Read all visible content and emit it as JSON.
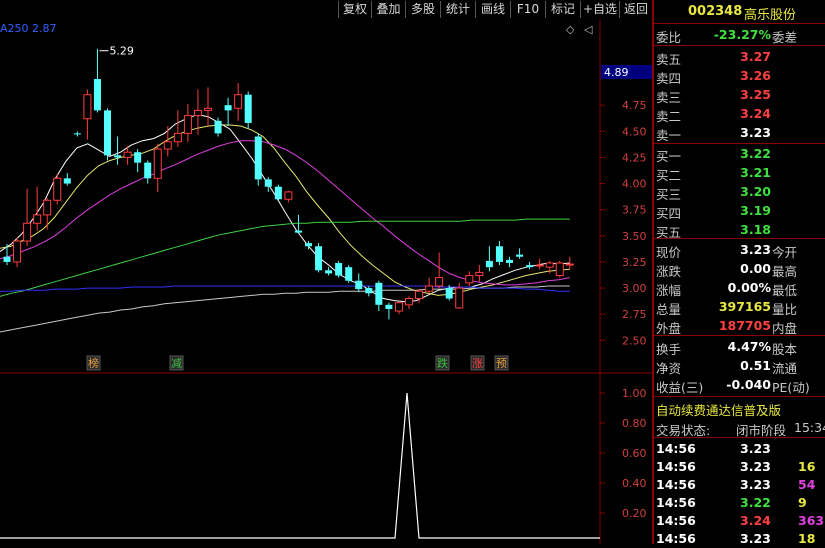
{
  "toolbar": {
    "buttons": [
      "复权",
      "叠加",
      "多股",
      "统计",
      "画线",
      "F10",
      "标记",
      "+自选",
      "返回"
    ]
  },
  "main_chart": {
    "indicator_label": "A250",
    "indicator_value": "2.87",
    "high_label": "5.29",
    "price_marker": "4.89",
    "y_ticks": [
      "4.75",
      "4.50",
      "4.25",
      "4.00",
      "3.75",
      "3.50",
      "3.25",
      "3.00",
      "2.75",
      "2.50"
    ],
    "markers": [
      {
        "text": "榜",
        "color": "#e8a040"
      },
      {
        "text": "减",
        "color": "#40c040"
      },
      {
        "text": "跌",
        "color": "#40c040"
      },
      {
        "text": "涨",
        "color": "#ff4040"
      },
      {
        "text": "预",
        "color": "#e8a040"
      }
    ]
  },
  "sub_chart": {
    "y_ticks": [
      "1.00",
      "0.80",
      "0.60",
      "0.40",
      "0.20"
    ],
    "signal_value": 1.0
  },
  "chart_data": {
    "type": "candlestick",
    "candles": [
      {
        "o": 3.3,
        "h": 3.42,
        "l": 3.22,
        "c": 3.25
      },
      {
        "o": 3.25,
        "h": 3.48,
        "l": 3.2,
        "c": 3.45
      },
      {
        "o": 3.45,
        "h": 3.95,
        "l": 3.4,
        "c": 3.62
      },
      {
        "o": 3.62,
        "h": 3.97,
        "l": 3.55,
        "c": 3.7
      },
      {
        "o": 3.7,
        "h": 3.86,
        "l": 3.56,
        "c": 3.84
      },
      {
        "o": 3.84,
        "h": 4.09,
        "l": 3.8,
        "c": 4.05
      },
      {
        "o": 4.05,
        "h": 4.1,
        "l": 3.98,
        "c": 4.0
      },
      {
        "o": 4.48,
        "h": 4.5,
        "l": 4.45,
        "c": 4.47
      },
      {
        "o": 4.62,
        "h": 4.9,
        "l": 4.42,
        "c": 4.85
      },
      {
        "o": 5.0,
        "h": 5.29,
        "l": 4.68,
        "c": 4.7
      },
      {
        "o": 4.7,
        "h": 4.72,
        "l": 4.22,
        "c": 4.27
      },
      {
        "o": 4.27,
        "h": 4.45,
        "l": 4.18,
        "c": 4.25
      },
      {
        "o": 4.25,
        "h": 4.36,
        "l": 4.18,
        "c": 4.3
      },
      {
        "o": 4.3,
        "h": 4.33,
        "l": 4.11,
        "c": 4.2
      },
      {
        "o": 4.2,
        "h": 4.22,
        "l": 4.0,
        "c": 4.05
      },
      {
        "o": 4.05,
        "h": 4.38,
        "l": 3.92,
        "c": 4.33
      },
      {
        "o": 4.33,
        "h": 4.55,
        "l": 4.26,
        "c": 4.4
      },
      {
        "o": 4.4,
        "h": 4.7,
        "l": 4.35,
        "c": 4.48
      },
      {
        "o": 4.48,
        "h": 4.76,
        "l": 4.4,
        "c": 4.65
      },
      {
        "o": 4.65,
        "h": 4.9,
        "l": 4.47,
        "c": 4.7
      },
      {
        "o": 4.7,
        "h": 4.92,
        "l": 4.55,
        "c": 4.72
      },
      {
        "o": 4.6,
        "h": 4.63,
        "l": 4.45,
        "c": 4.48
      },
      {
        "o": 4.75,
        "h": 4.82,
        "l": 4.55,
        "c": 4.7
      },
      {
        "o": 4.72,
        "h": 4.96,
        "l": 4.6,
        "c": 4.85
      },
      {
        "o": 4.85,
        "h": 4.88,
        "l": 4.53,
        "c": 4.58
      },
      {
        "o": 4.45,
        "h": 4.48,
        "l": 3.98,
        "c": 4.04
      },
      {
        "o": 4.04,
        "h": 4.06,
        "l": 3.92,
        "c": 3.97
      },
      {
        "o": 3.97,
        "h": 3.99,
        "l": 3.83,
        "c": 3.85
      },
      {
        "o": 3.85,
        "h": 3.93,
        "l": 3.82,
        "c": 3.92
      },
      {
        "o": 3.55,
        "h": 3.7,
        "l": 3.52,
        "c": 3.53
      },
      {
        "o": 3.43,
        "h": 3.45,
        "l": 3.37,
        "c": 3.4
      },
      {
        "o": 3.4,
        "h": 3.43,
        "l": 3.15,
        "c": 3.17
      },
      {
        "o": 3.17,
        "h": 3.2,
        "l": 3.12,
        "c": 3.14
      },
      {
        "o": 3.24,
        "h": 3.26,
        "l": 3.1,
        "c": 3.12
      },
      {
        "o": 3.2,
        "h": 3.22,
        "l": 3.05,
        "c": 3.07
      },
      {
        "o": 3.07,
        "h": 3.14,
        "l": 2.96,
        "c": 2.99
      },
      {
        "o": 3.0,
        "h": 3.02,
        "l": 2.92,
        "c": 2.95
      },
      {
        "o": 3.05,
        "h": 3.07,
        "l": 2.78,
        "c": 2.84
      },
      {
        "o": 2.84,
        "h": 2.86,
        "l": 2.7,
        "c": 2.8
      },
      {
        "o": 2.78,
        "h": 2.87,
        "l": 2.75,
        "c": 2.86
      },
      {
        "o": 2.84,
        "h": 2.92,
        "l": 2.8,
        "c": 2.9
      },
      {
        "o": 2.9,
        "h": 2.99,
        "l": 2.86,
        "c": 2.97
      },
      {
        "o": 2.97,
        "h": 3.1,
        "l": 2.95,
        "c": 3.02
      },
      {
        "o": 3.02,
        "h": 3.34,
        "l": 3.0,
        "c": 3.1
      },
      {
        "o": 3.0,
        "h": 3.03,
        "l": 2.88,
        "c": 2.9
      },
      {
        "o": 2.81,
        "h": 3.05,
        "l": 2.8,
        "c": 3.0
      },
      {
        "o": 3.05,
        "h": 3.16,
        "l": 3.02,
        "c": 3.12
      },
      {
        "o": 3.12,
        "h": 3.22,
        "l": 3.06,
        "c": 3.15
      },
      {
        "o": 3.26,
        "h": 3.4,
        "l": 3.16,
        "c": 3.2
      },
      {
        "o": 3.4,
        "h": 3.45,
        "l": 3.22,
        "c": 3.25
      },
      {
        "o": 3.27,
        "h": 3.3,
        "l": 3.2,
        "c": 3.24
      },
      {
        "o": 3.32,
        "h": 3.38,
        "l": 3.28,
        "c": 3.3
      },
      {
        "o": 3.22,
        "h": 3.25,
        "l": 3.18,
        "c": 3.2
      },
      {
        "o": 3.22,
        "h": 3.28,
        "l": 3.18,
        "c": 3.22
      },
      {
        "o": 3.2,
        "h": 3.26,
        "l": 3.14,
        "c": 3.24
      },
      {
        "o": 3.12,
        "h": 3.26,
        "l": 3.1,
        "c": 3.24
      },
      {
        "o": 3.23,
        "h": 3.3,
        "l": 3.18,
        "c": 3.23
      }
    ],
    "ma_lines": [
      {
        "name": "ma5",
        "color": "#ffffff",
        "values": [
          3.35,
          3.42,
          3.52,
          3.66,
          3.82,
          4.04,
          4.21,
          4.34,
          4.38,
          4.32,
          4.26,
          4.3,
          4.37,
          4.41,
          4.43,
          4.48,
          4.57,
          4.62,
          4.66,
          4.64,
          4.58,
          4.52,
          4.38,
          4.24,
          4.07,
          3.91,
          3.73,
          3.56,
          3.42,
          3.3,
          3.22,
          3.13,
          3.07,
          3.03,
          2.96,
          2.9,
          2.88,
          2.87,
          2.88,
          2.93,
          2.98,
          3.0,
          3.01,
          3.01,
          3.04,
          3.09,
          3.13,
          3.17,
          3.2,
          3.22,
          3.24,
          3.23,
          3.24
        ]
      },
      {
        "name": "ma10",
        "color": "#e8e870",
        "values": [
          3.38,
          3.4,
          3.45,
          3.5,
          3.57,
          3.68,
          3.82,
          3.96,
          4.08,
          4.17,
          4.22,
          4.25,
          4.27,
          4.29,
          4.33,
          4.4,
          4.46,
          4.5,
          4.53,
          4.55,
          4.56,
          4.56,
          4.55,
          4.51,
          4.45,
          4.34,
          4.2,
          4.07,
          3.92,
          3.79,
          3.67,
          3.53,
          3.41,
          3.31,
          3.22,
          3.14,
          3.06,
          3.01,
          2.97,
          2.95,
          2.93,
          2.94,
          2.96,
          2.99,
          3.01,
          3.03,
          3.06,
          3.09,
          3.12,
          3.14,
          3.16,
          3.17,
          3.18
        ]
      },
      {
        "name": "ma20",
        "color": "#e040e0",
        "values": [
          3.28,
          3.31,
          3.35,
          3.39,
          3.44,
          3.5,
          3.58,
          3.67,
          3.75,
          3.82,
          3.89,
          3.95,
          4.0,
          4.05,
          4.09,
          4.14,
          4.18,
          4.23,
          4.28,
          4.32,
          4.36,
          4.39,
          4.41,
          4.41,
          4.4,
          4.37,
          4.33,
          4.27,
          4.2,
          4.12,
          4.03,
          3.94,
          3.85,
          3.76,
          3.67,
          3.59,
          3.5,
          3.42,
          3.34,
          3.27,
          3.2,
          3.14,
          3.1,
          3.07,
          3.05,
          3.04,
          3.03,
          3.03,
          3.04,
          3.05,
          3.07,
          3.08,
          3.1
        ]
      },
      {
        "name": "ma60",
        "color": "#40d040",
        "values": [
          2.92,
          2.95,
          2.97,
          3.0,
          3.03,
          3.06,
          3.09,
          3.12,
          3.15,
          3.18,
          3.21,
          3.24,
          3.27,
          3.3,
          3.33,
          3.36,
          3.39,
          3.42,
          3.45,
          3.48,
          3.51,
          3.53,
          3.55,
          3.57,
          3.59,
          3.6,
          3.61,
          3.62,
          3.62,
          3.63,
          3.63,
          3.63,
          3.63,
          3.64,
          3.64,
          3.64,
          3.64,
          3.64,
          3.64,
          3.64,
          3.64,
          3.64,
          3.64,
          3.65,
          3.65,
          3.65,
          3.65,
          3.65,
          3.66,
          3.66,
          3.66,
          3.66,
          3.66
        ]
      },
      {
        "name": "ma120",
        "color": "#c8c8c8",
        "values": [
          2.58,
          2.6,
          2.62,
          2.64,
          2.66,
          2.68,
          2.7,
          2.72,
          2.74,
          2.76,
          2.77,
          2.79,
          2.8,
          2.82,
          2.83,
          2.85,
          2.86,
          2.87,
          2.88,
          2.89,
          2.9,
          2.91,
          2.92,
          2.93,
          2.94,
          2.94,
          2.95,
          2.95,
          2.96,
          2.96,
          2.96,
          2.97,
          2.97,
          2.97,
          2.97,
          2.98,
          2.98,
          2.98,
          2.98,
          2.99,
          2.99,
          2.99,
          2.99,
          3.0,
          3.0,
          3.0,
          3.0,
          3.01,
          3.01,
          3.01,
          3.02,
          3.02,
          3.02
        ]
      },
      {
        "name": "ma250",
        "color": "#3030ff",
        "values": [
          2.97,
          2.97,
          2.98,
          2.98,
          2.98,
          2.99,
          2.99,
          2.99,
          3.0,
          3.0,
          3.0,
          3.0,
          3.01,
          3.01,
          3.01,
          3.01,
          3.02,
          3.02,
          3.02,
          3.02,
          3.02,
          3.02,
          3.02,
          3.02,
          3.02,
          3.02,
          3.02,
          3.02,
          3.02,
          3.02,
          3.02,
          3.02,
          3.02,
          3.02,
          3.02,
          3.02,
          3.02,
          3.02,
          3.02,
          3.02,
          3.01,
          3.01,
          3.01,
          3.01,
          3.0,
          3.0,
          3.0,
          3.0,
          2.99,
          2.99,
          2.98,
          2.97,
          2.97
        ]
      }
    ],
    "ylim": [
      2.35,
      5.45
    ]
  },
  "quote_panel": {
    "code": "002348",
    "name": "高乐股份",
    "weibi_label": "委比",
    "weibi_value": "-23.27%",
    "weicha_label": "委差",
    "asks": [
      {
        "label": "卖五",
        "price": "3.27"
      },
      {
        "label": "卖四",
        "price": "3.26"
      },
      {
        "label": "卖三",
        "price": "3.25"
      },
      {
        "label": "卖二",
        "price": "3.24"
      },
      {
        "label": "卖一",
        "price": "3.23"
      }
    ],
    "bids": [
      {
        "label": "买一",
        "price": "3.22"
      },
      {
        "label": "买二",
        "price": "3.21"
      },
      {
        "label": "买三",
        "price": "3.20"
      },
      {
        "label": "买四",
        "price": "3.19"
      },
      {
        "label": "买五",
        "price": "3.18"
      }
    ],
    "stats": [
      {
        "label": "现价",
        "value": "3.23",
        "color": "#ffffff",
        "label2": "今开"
      },
      {
        "label": "涨跌",
        "value": "0.00",
        "color": "#ffffff",
        "label2": "最高"
      },
      {
        "label": "涨幅",
        "value": "0.00%",
        "color": "#ffffff",
        "label2": "最低"
      },
      {
        "label": "总量",
        "value": "397165",
        "color": "#e8e840",
        "label2": "量比"
      },
      {
        "label": "外盘",
        "value": "187705",
        "color": "#ff4040",
        "label2": "内盘"
      }
    ],
    "stats2": [
      {
        "label": "换手",
        "value": "4.47%",
        "color": "#ffffff",
        "label2": "股本"
      },
      {
        "label": "净资",
        "value": "0.51",
        "color": "#ffffff",
        "label2": "流通"
      },
      {
        "label": "收益(三)",
        "value": "-0.040",
        "color": "#ffffff",
        "label2": "PE(动)"
      }
    ],
    "promo": "自动续费通达信普及版",
    "trade_status_label": "交易状态:",
    "trade_status_value": "闭市阶段",
    "trade_time": "15:34",
    "ticks": [
      {
        "time": "14:56",
        "price": "3.23",
        "price_color": "#ffffff",
        "vol": "",
        "vol_color": "#ffffff"
      },
      {
        "time": "14:56",
        "price": "3.23",
        "price_color": "#ffffff",
        "vol": "16",
        "vol_color": "#e8e840"
      },
      {
        "time": "14:56",
        "price": "3.23",
        "price_color": "#ffffff",
        "vol": "54",
        "vol_color": "#e040e0"
      },
      {
        "time": "14:56",
        "price": "3.22",
        "price_color": "#40e040",
        "vol": "9",
        "vol_color": "#e8e840"
      },
      {
        "time": "14:56",
        "price": "3.24",
        "price_color": "#ff4040",
        "vol": "363",
        "vol_color": "#e040e0"
      },
      {
        "time": "14:56",
        "price": "3.23",
        "price_color": "#ffffff",
        "vol": "18",
        "vol_color": "#e8e840"
      }
    ]
  }
}
